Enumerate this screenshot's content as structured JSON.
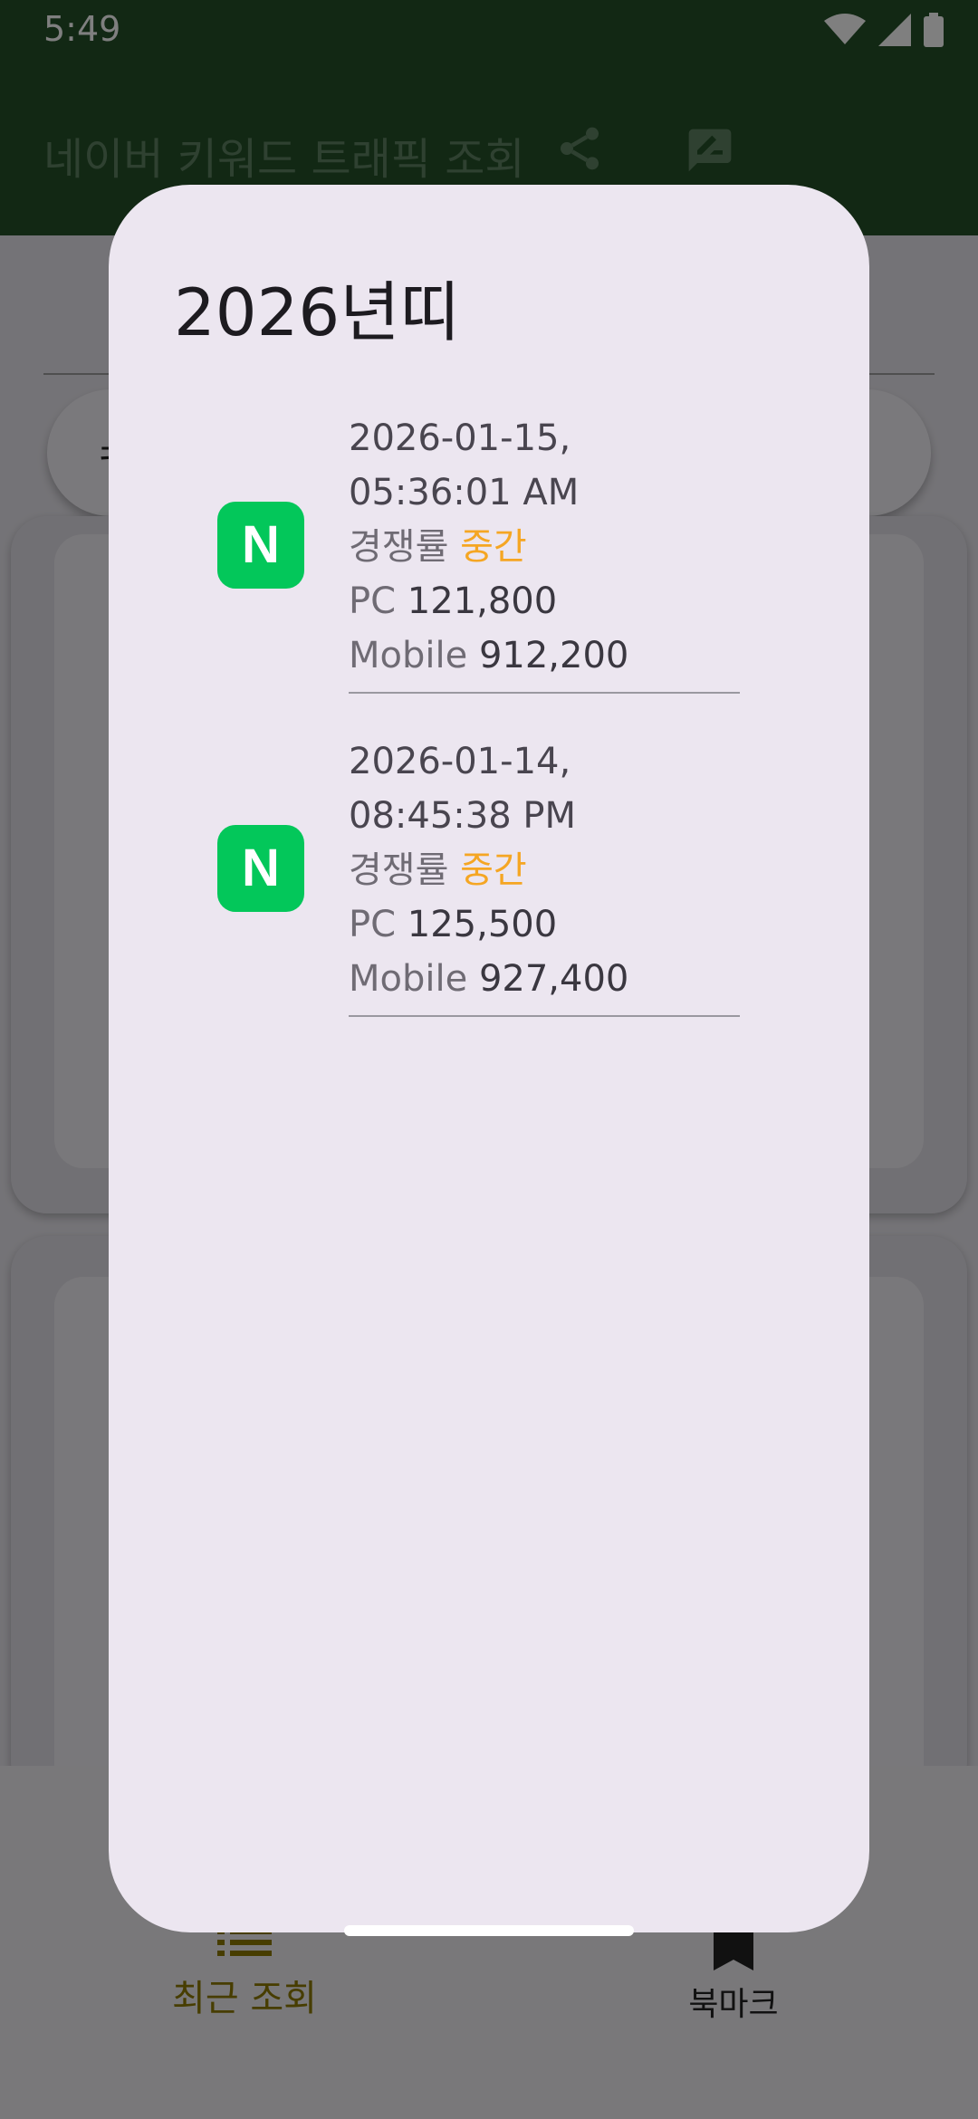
{
  "status_bar": {
    "time": "5:49"
  },
  "app_bar": {
    "title": "네이버 키워드 트래픽 조회"
  },
  "bottom_nav": {
    "recent_label": "최근 조회",
    "bookmark_label": "북마크"
  },
  "dialog": {
    "title": "2026년띠",
    "items": [
      {
        "badge": "N",
        "timestamp": "2026-01-15, 05:36:01 AM",
        "competition_label": "경쟁률",
        "competition_value": "중간",
        "pc_label": "PC",
        "pc_value": "121,800",
        "mobile_label": "Mobile",
        "mobile_value": "912,200"
      },
      {
        "badge": "N",
        "timestamp": "2026-01-14, 08:45:38 PM",
        "competition_label": "경쟁률",
        "competition_value": "중간",
        "pc_label": "PC",
        "pc_value": "125,500",
        "mobile_label": "Mobile",
        "mobile_value": "927,400"
      }
    ]
  },
  "colors": {
    "app_bar": "#245128",
    "naver_green": "#03c75a",
    "competition_orange": "#f5a623",
    "dialog_surface": "#ece6f0"
  },
  "icons": {
    "status": [
      "wifi-icon",
      "cell-signal-icon",
      "battery-icon"
    ],
    "app_bar": [
      "share-icon",
      "feedback-icon"
    ],
    "bottom_nav": [
      "list-icon",
      "bookmark-icon"
    ]
  }
}
